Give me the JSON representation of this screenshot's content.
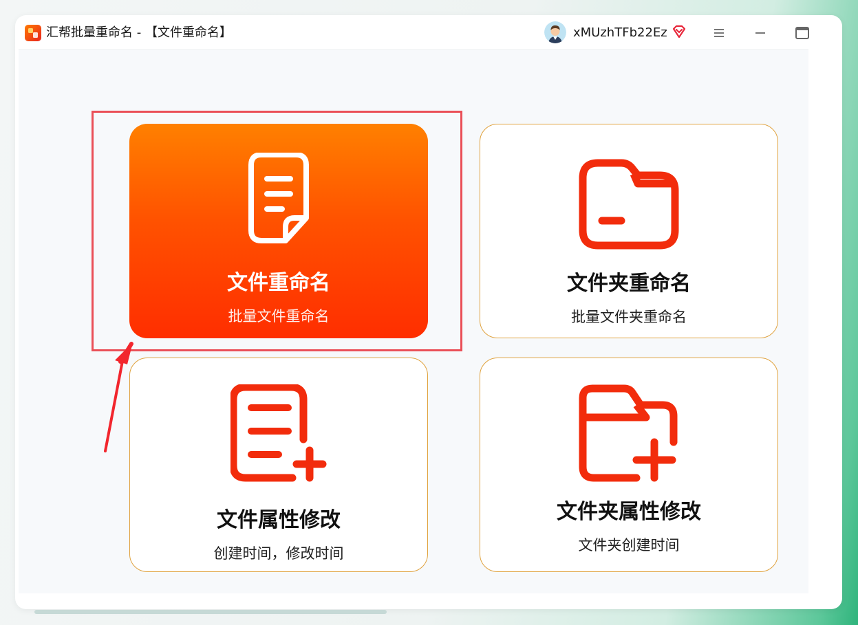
{
  "app": {
    "title": "汇帮批量重命名 - 【文件重命名】",
    "logo_icon": "app-logo-icon"
  },
  "user": {
    "name": "xMUzhTFb22Ez",
    "avatar_icon": "user-avatar",
    "badge_icon": "vip-diamond-icon"
  },
  "window_controls": {
    "menu_icon": "hamburger-menu-icon",
    "minimize_icon": "minimize-icon",
    "maximize_icon": "maximize-icon"
  },
  "cards": [
    {
      "title": "文件重命名",
      "subtitle": "批量文件重命名",
      "icon": "document-icon",
      "active": true
    },
    {
      "title": "文件夹重命名",
      "subtitle": "批量文件夹重命名",
      "icon": "folder-icon",
      "active": false
    },
    {
      "title": "文件属性修改",
      "subtitle": "创建时间，修改时间",
      "icon": "document-add-icon",
      "active": false
    },
    {
      "title": "文件夹属性修改",
      "subtitle": "文件夹创建时间",
      "icon": "folder-add-icon",
      "active": false
    }
  ],
  "colors": {
    "accent_red": "#f22c0c",
    "active_gradient_top": "#ff8000",
    "active_gradient_bottom": "#ff2e00",
    "card_border": "#e0a23e",
    "highlight": "#ea4f57"
  }
}
